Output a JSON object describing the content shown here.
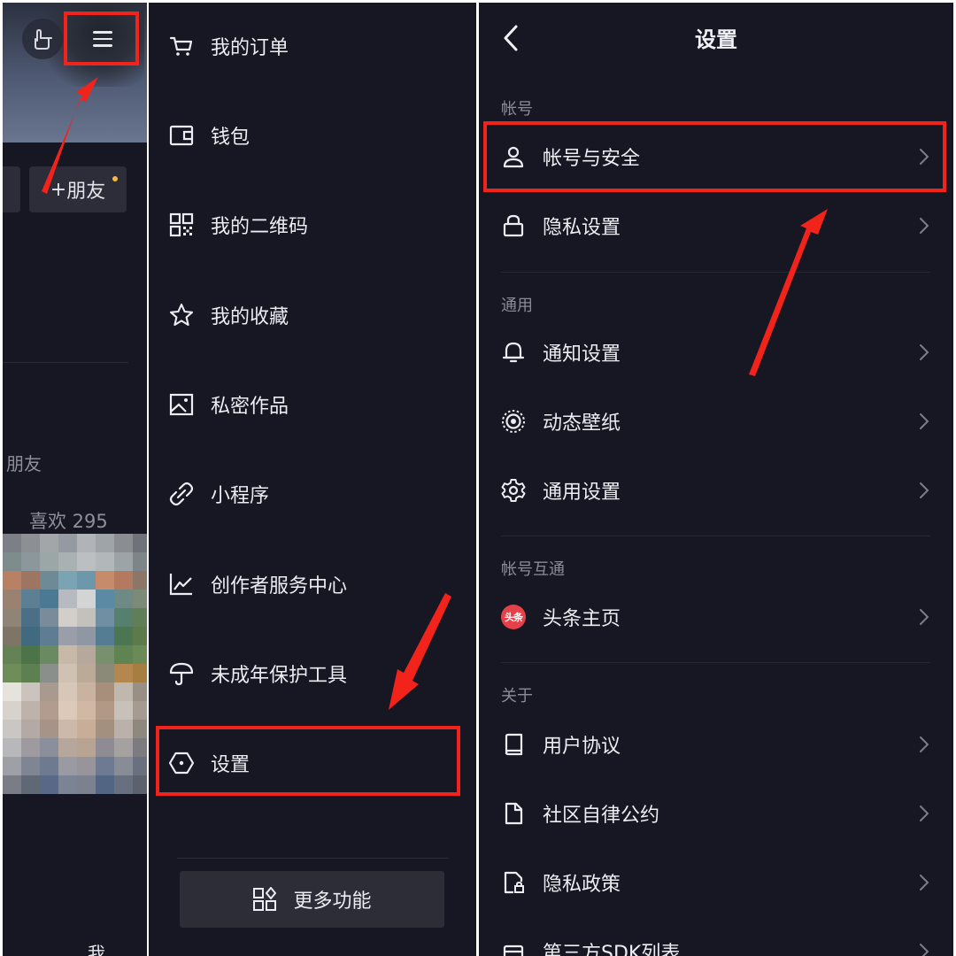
{
  "profile": {
    "add_friend_label": "朋友",
    "add_friend_plus": "+",
    "friend_text": "朋友",
    "likes_text": "喜欢 295",
    "bottom_tab_label": "我",
    "mosaic_colors": [
      "#7c7f85",
      "#8c8f94",
      "#a3a6a9",
      "#939aa2",
      "#b0b3b7",
      "#9fa4a8",
      "#8a8e93",
      "#6f7379",
      "#7f8c8e",
      "#8b979a",
      "#9ba7a7",
      "#a9b1b3",
      "#bcbfc1",
      "#b2b7ba",
      "#9da4a8",
      "#7d8589",
      "#b98164",
      "#9d7560",
      "#6f8a97",
      "#7aa3b4",
      "#6d97aa",
      "#c68b6a",
      "#b47a60",
      "#8d7668",
      "#9a8170",
      "#5d7f93",
      "#4b7994",
      "#b7bbc1",
      "#d3d4d6",
      "#5b8aa5",
      "#6d8a84",
      "#7c8a78",
      "#8f8476",
      "#4b6f86",
      "#7a8b99",
      "#d2cfcb",
      "#c4c0bc",
      "#708fa3",
      "#55806d",
      "#607e58",
      "#7e7566",
      "#426a7e",
      "#5e7d92",
      "#9a9ea8",
      "#8f97a2",
      "#557c92",
      "#4c7552",
      "#5b7b4c",
      "#658156",
      "#4d7449",
      "#6a8b62",
      "#c7b8a8",
      "#b6a89c",
      "#78906e",
      "#5f8351",
      "#6c8a57",
      "#6f8d59",
      "#5e7f4f",
      "#8a8f8b",
      "#d0c2b3",
      "#bcaa99",
      "#8b8a79",
      "#b4874f",
      "#a87d42",
      "#e6e2dc",
      "#cbc3bd",
      "#a99a8f",
      "#d6c7b8",
      "#c9b3a0",
      "#a88f7c",
      "#c0b7ad",
      "#9a8f85",
      "#d7d2cc",
      "#bdb3ab",
      "#b19c8d",
      "#dcc9b9",
      "#cfb8a4",
      "#b19985",
      "#c8c1b9",
      "#a69b91",
      "#cac6c3",
      "#b3aaa5",
      "#a69488",
      "#cdb9a9",
      "#c8ad97",
      "#a4907f",
      "#b9b1aa",
      "#8f887f",
      "#b8b7b9",
      "#9d9aa0",
      "#8b8f9b",
      "#b6a79c",
      "#b9a493",
      "#8e8b92",
      "#a6a1a1",
      "#7d7b80",
      "#9ea0a6",
      "#7e8593",
      "#6e7a90",
      "#9a9aa2",
      "#98949b",
      "#6d7a91",
      "#878c97",
      "#6b7080",
      "#7a7d85",
      "#606876",
      "#576987",
      "#7c8394",
      "#7b818f",
      "#526684",
      "#68707f",
      "#5b616e"
    ]
  },
  "menu": {
    "items": [
      {
        "label": "我的订单"
      },
      {
        "label": "钱包"
      },
      {
        "label": "我的二维码"
      },
      {
        "label": "我的收藏"
      },
      {
        "label": "私密作品"
      },
      {
        "label": "小程序"
      },
      {
        "label": "创作者服务中心"
      },
      {
        "label": "未成年保护工具"
      },
      {
        "label": "设置"
      }
    ],
    "more_label": "更多功能"
  },
  "settings": {
    "title": "设置",
    "sections": [
      {
        "header": "帐号",
        "items": [
          {
            "label": "帐号与安全"
          },
          {
            "label": "隐私设置"
          }
        ]
      },
      {
        "header": "通用",
        "items": [
          {
            "label": "通知设置"
          },
          {
            "label": "动态壁纸"
          },
          {
            "label": "通用设置"
          }
        ]
      },
      {
        "header": "帐号互通",
        "items": [
          {
            "label": "头条主页",
            "badge": "头条"
          }
        ]
      },
      {
        "header": "关于",
        "items": [
          {
            "label": "用户协议"
          },
          {
            "label": "社区自律公约"
          },
          {
            "label": "隐私政策"
          },
          {
            "label": "第三方SDK列表"
          }
        ]
      }
    ]
  },
  "colors": {
    "background": "#161722",
    "highlight": "#f2231b",
    "text_primary": "#ececf2",
    "text_secondary": "#8a8b95",
    "toutiao_red": "#e6404a",
    "notify_dot": "#f5b740"
  }
}
